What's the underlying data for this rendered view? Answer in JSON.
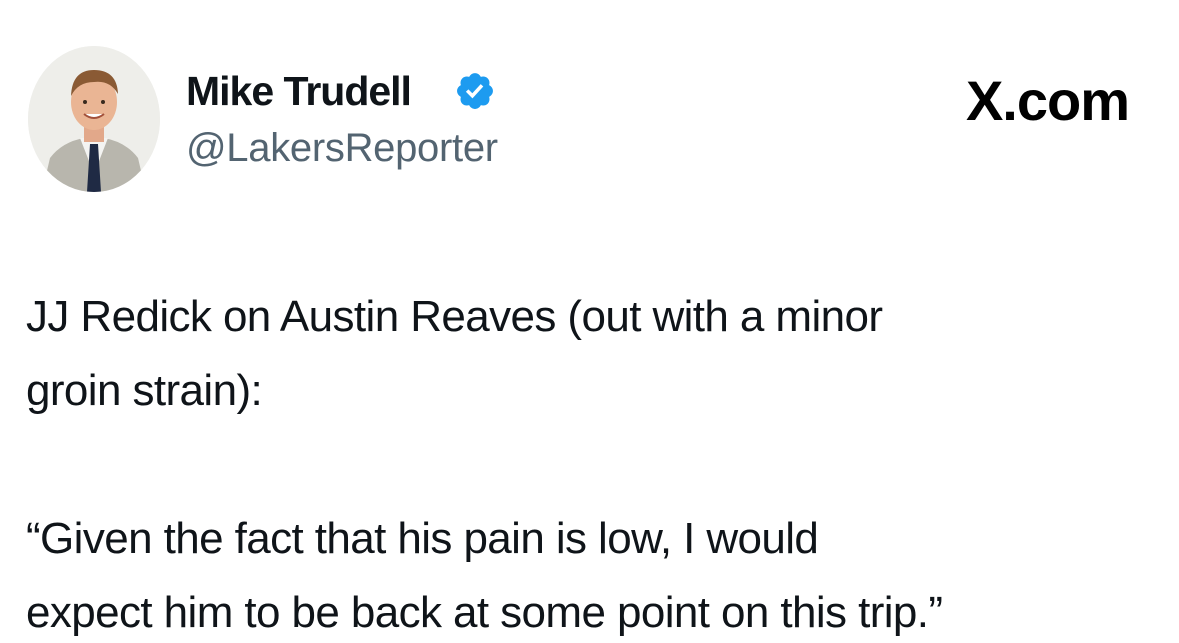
{
  "author": {
    "display_name": "Mike Trudell",
    "handle": "@LakersReporter",
    "verified": true,
    "avatar_icon": "profile-photo"
  },
  "brand": {
    "label": "X.com"
  },
  "tweet": {
    "paragraph_1_line_1": "JJ Redick on Austin Reaves (out with a minor",
    "paragraph_1_line_2": "groin strain):",
    "paragraph_2_line_1": "“Given the fact that his pain is low, I would",
    "paragraph_2_line_2": "expect him to be back at some point on this trip.”"
  },
  "colors": {
    "verified_badge": "#1d9bf0",
    "handle": "#536471",
    "text": "#0f1419"
  }
}
